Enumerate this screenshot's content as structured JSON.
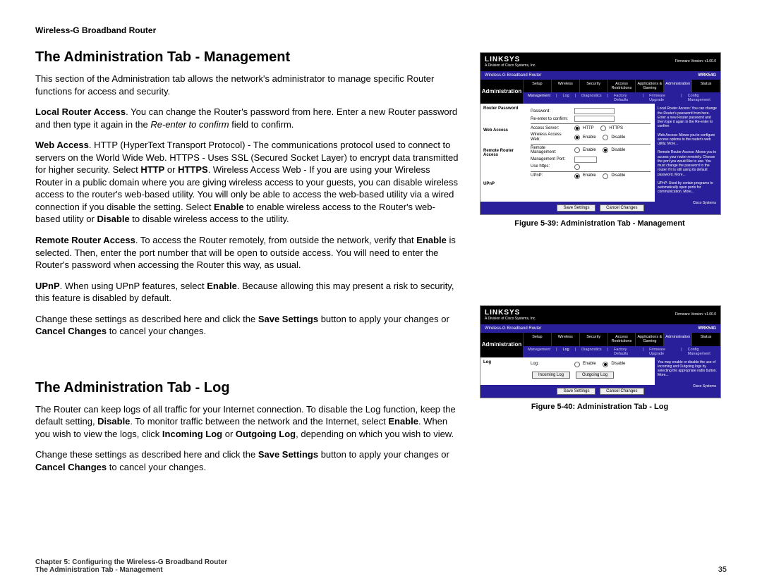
{
  "runhead": "Wireless-G Broadband Router",
  "section1": {
    "heading": "The Administration Tab - Management",
    "intro": "This section of the Administration tab allows the network's administrator to manage specific Router functions for access and security.",
    "p1_a": "Local Router Access",
    "p1_b": ". You can change the Router's password from here. Enter a new Router password and then type it again in the ",
    "p1_c": "Re-enter to confirm",
    "p1_d": " field to confirm.",
    "p2_a": "Web Access",
    "p2_b": ". HTTP (HyperText Transport Protocol) - The communications protocol used to connect to servers on the World Wide Web. HTTPS - Uses SSL (Secured Socket Layer) to encrypt data transmitted for higher security. Select ",
    "p2_c": "HTTP",
    "p2_d": " or ",
    "p2_e": "HTTPS",
    "p2_f": ". Wireless Access Web - If you are using your Wireless Router in a public domain where you are giving wireless access to your guests, you can disable wireless access to the router's web-based utility. You will only be able to access the web-based utility via a wired connection if you disable the setting. Select ",
    "p2_g": "Enable",
    "p2_h": " to enable wireless access to the Router's web-based utility or ",
    "p2_i": "Disable",
    "p2_j": " to disable wireless access to the utility.",
    "p3_a": "Remote Router Access",
    "p3_b": ". To access the Router remotely, from outside the network, verify that ",
    "p3_c": "Enable",
    "p3_d": " is selected. Then, enter the port number that will be open to outside access. You will need to enter the Router's password when accessing the Router this way, as usual.",
    "p4_a": "UPnP",
    "p4_b": ". When using UPnP features, select ",
    "p4_c": "Enable",
    "p4_d": ". Because allowing this may present a risk to security, this feature is disabled by default.",
    "p5_a": "Change these settings as described here and click the ",
    "p5_b": "Save Settings",
    "p5_c": " button to apply your changes or ",
    "p5_d": "Cancel Changes",
    "p5_e": " to cancel your changes."
  },
  "section2": {
    "heading": "The Administration Tab - Log",
    "p1_a": "The Router can keep logs of all traffic for your Internet connection. To disable the Log function, keep the default setting, ",
    "p1_b": "Disable",
    "p1_c": ". To monitor traffic between the network and the Internet, select ",
    "p1_d": "Enable",
    "p1_e": ". When you wish to view the logs, click ",
    "p1_f": "Incoming Log",
    "p1_g": " or ",
    "p1_h": "Outgoing Log",
    "p1_i": ", depending on which you wish to view.",
    "p2_a": "Change these settings as described here and click the ",
    "p2_b": "Save Settings",
    "p2_c": " button to apply your changes or ",
    "p2_d": "Cancel Changes",
    "p2_e": " to cancel your changes."
  },
  "captions": {
    "c1": "Figure 5-39: Administration Tab - Management",
    "c2": "Figure 5-40: Administration Tab - Log"
  },
  "footer": {
    "line1": "Chapter 5: Configuring the Wireless-G Broadband Router",
    "line2": "The Administration Tab - Management",
    "page": "35"
  },
  "router": {
    "brand": "LINKSYS",
    "brandsub": "A Division of Cisco Systems, Inc.",
    "fw_label": "Firmware Version: v1.00.0",
    "band_left": "Wireless-G Broadband Router",
    "band_right": "WRK54G",
    "tabs": [
      "Setup",
      "Wireless",
      "Security",
      "Access Restrictions",
      "Applications & Gaming",
      "Administration",
      "Status"
    ],
    "subtabs1": [
      "Management",
      "Log",
      "Diagnostics",
      "Factory Defaults",
      "Firmware Upgrade",
      "Config Management"
    ],
    "section_label": "Administration",
    "mgmt_groups": [
      "Router Password",
      "Web Access",
      "Remote Router Access",
      "UPnP"
    ],
    "mgmt_fields": {
      "password": "Password:",
      "reenter": "Re-enter to confirm:",
      "access_server": "Access Server:",
      "http": "HTTP",
      "https": "HTTPS",
      "wireless_access": "Wireless Access Web:",
      "enable": "Enable",
      "disable": "Disable",
      "remote_mgmt": "Remote Management:",
      "mgmt_port": "Management Port:",
      "use_https": "Use https:",
      "upnp": "UPnP:"
    },
    "help1": [
      "Local Router Access: You can change the Router's password from here. Enter a new Router password and then type it again in the Re-enter to confirm",
      "Web Access: Allows you to configure access options to the router's web utility. More...",
      "Remote Router Access: Allows you to access your router remotely. Choose the port you would like to use. You must change the password to the router if it is still using its default password. More..."
    ],
    "help1b": "UPnP: Used by certain programs to automatically open ports for communication. More...",
    "log_group": "Log",
    "log_field": "Log:",
    "incoming": "Incoming Log",
    "outgoing": "Outgoing Log",
    "help2": "You may enable or disable the use of Incoming and Outgoing logs by selecting the appropriate radio button. More...",
    "save": "Save Settings",
    "cancel": "Cancel Changes",
    "cisco": "Cisco Systems"
  }
}
